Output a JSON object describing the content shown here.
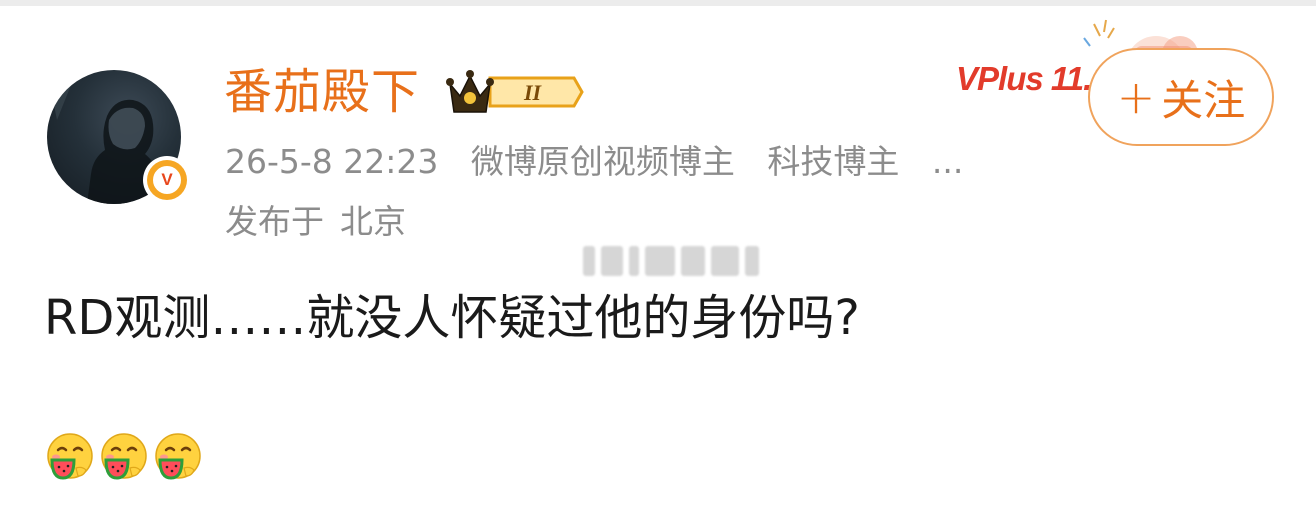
{
  "post": {
    "author": {
      "name": "番茄殿下",
      "verified_badge": "V",
      "vip_level": "II"
    },
    "timestamp": "26-5-8 22:23",
    "tags": [
      "微博原创视频博主",
      "科技博主",
      "..."
    ],
    "location_prefix": "发布于",
    "location": "北京",
    "content": "RD观测……就没人怀疑过他的身份吗?",
    "emojis": [
      "eating-watermelon-emoji",
      "eating-watermelon-emoji",
      "eating-watermelon-emoji"
    ]
  },
  "follow_button": {
    "plus": "+",
    "label": "关注"
  },
  "promo": {
    "text": "VPlus 11.11"
  },
  "colors": {
    "accent": "#e8701a",
    "meta": "#8c8c8c",
    "text": "#1a1a1a",
    "follow_border": "#f0a35c"
  }
}
